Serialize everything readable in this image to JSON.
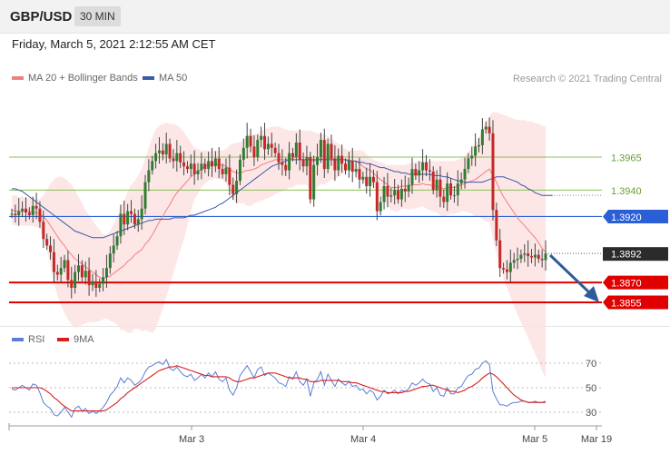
{
  "header": {
    "symbol": "GBP/USD",
    "timeframe": "30 MIN",
    "datetime": "Friday, March 5, 2021 2:12:55 AM CET"
  },
  "legend_main": {
    "ma20_bb": "MA 20 + Bollinger Bands",
    "ma50": "MA 50"
  },
  "legend_rsi": {
    "rsi": "RSI",
    "ma9": "9MA"
  },
  "copyright": "Research © 2021 Trading Central",
  "colors": {
    "up_candle": "#2e7d32",
    "down_candle": "#c62828",
    "bollinger_fill": "#fde2e2",
    "ma20": "#f08080",
    "ma50": "#3b5aa6",
    "rsi": "#5b7fd6",
    "rsi_ma": "#d91e1e",
    "support": "#e00000",
    "pivot": "#2a5fd6",
    "resistance": "#8cbf5a",
    "arrow": "#2f5b9a"
  },
  "chart_data": [
    {
      "type": "candlestick",
      "title": "",
      "x_ticks": [
        "Mar 3",
        "Mar 4",
        "Mar 5",
        "Mar 19"
      ],
      "ylim": [
        1.3845,
        1.3995
      ],
      "levels": [
        {
          "value": 1.3965,
          "label": "1.3965",
          "kind": "resistance"
        },
        {
          "value": 1.394,
          "label": "1.3940",
          "kind": "resistance"
        },
        {
          "value": 1.392,
          "label": "1.3920",
          "kind": "pivot"
        },
        {
          "value": 1.3892,
          "label": "1.3892",
          "kind": "last"
        },
        {
          "value": 1.387,
          "label": "1.3870",
          "kind": "support"
        },
        {
          "value": 1.3855,
          "label": "1.3855",
          "kind": "support"
        }
      ],
      "close": [
        1.3922,
        1.3921,
        1.3924,
        1.3926,
        1.3923,
        1.3921,
        1.3928,
        1.3926,
        1.3916,
        1.3903,
        1.3898,
        1.3893,
        1.3878,
        1.3876,
        1.3881,
        1.3887,
        1.3872,
        1.3866,
        1.3878,
        1.3883,
        1.3874,
        1.3879,
        1.3868,
        1.3871,
        1.3866,
        1.3869,
        1.3874,
        1.3881,
        1.3892,
        1.3898,
        1.3905,
        1.3922,
        1.3914,
        1.3924,
        1.3922,
        1.3914,
        1.3918,
        1.3926,
        1.3946,
        1.3955,
        1.3962,
        1.3968,
        1.397,
        1.3967,
        1.3975,
        1.3964,
        1.3962,
        1.3968,
        1.3961,
        1.3958,
        1.3956,
        1.396,
        1.3952,
        1.3955,
        1.396,
        1.3956,
        1.3962,
        1.3958,
        1.3964,
        1.3956,
        1.3952,
        1.3957,
        1.3944,
        1.3937,
        1.3947,
        1.3963,
        1.3972,
        1.3981,
        1.3973,
        1.3965,
        1.3978,
        1.3981,
        1.3971,
        1.3975,
        1.3972,
        1.3968,
        1.3961,
        1.3959,
        1.3955,
        1.3968,
        1.3965,
        1.3976,
        1.3963,
        1.3958,
        1.3965,
        1.3933,
        1.3959,
        1.3965,
        1.3978,
        1.3956,
        1.3975,
        1.3964,
        1.3955,
        1.3966,
        1.396,
        1.3955,
        1.3962,
        1.3954,
        1.3956,
        1.3948,
        1.395,
        1.3943,
        1.395,
        1.3946,
        1.3924,
        1.3931,
        1.3943,
        1.3935,
        1.3936,
        1.394,
        1.3933,
        1.3941,
        1.3939,
        1.3944,
        1.3956,
        1.3951,
        1.3955,
        1.3961,
        1.3955,
        1.3954,
        1.394,
        1.3948,
        1.3935,
        1.3931,
        1.3945,
        1.3936,
        1.3936,
        1.3945,
        1.3948,
        1.3956,
        1.3964,
        1.3966,
        1.3973,
        1.3974,
        1.3986,
        1.3988,
        1.3983,
        1.3925,
        1.3902,
        1.3881,
        1.388,
        1.3878,
        1.3885,
        1.3887,
        1.3888,
        1.3891,
        1.3892,
        1.389,
        1.3889,
        1.3891,
        1.3888,
        1.3887,
        1.3892
      ],
      "ma20": [
        1.3925,
        1.3924,
        1.3924,
        1.3924,
        1.3924,
        1.3924,
        1.3923,
        1.3923,
        1.3922,
        1.392,
        1.3917,
        1.3913,
        1.3909,
        1.3905,
        1.3901,
        1.3898,
        1.3894,
        1.3891,
        1.3888,
        1.3886,
        1.3884,
        1.3882,
        1.388,
        1.3878,
        1.3876,
        1.3874,
        1.3873,
        1.3874,
        1.3875,
        1.3877,
        1.3879,
        1.3881,
        1.3883,
        1.3886,
        1.3888,
        1.3891,
        1.3893,
        1.3895,
        1.3899,
        1.3902,
        1.3906,
        1.3911,
        1.3916,
        1.392,
        1.3925,
        1.3929,
        1.3934,
        1.3938,
        1.3941,
        1.3944,
        1.3947,
        1.395,
        1.3952,
        1.3954,
        1.3956,
        1.3958,
        1.3959,
        1.3959,
        1.396,
        1.3959,
        1.3959,
        1.3958,
        1.3956,
        1.3954,
        1.3953,
        1.3953,
        1.3954,
        1.3955,
        1.3955,
        1.3956,
        1.3957,
        1.3959,
        1.396,
        1.3961,
        1.3962,
        1.3963,
        1.3963,
        1.3963,
        1.3963,
        1.3964,
        1.3964,
        1.3965,
        1.3965,
        1.3965,
        1.3965,
        1.3962,
        1.3962,
        1.3963,
        1.3964,
        1.3963,
        1.3964,
        1.3964,
        1.3963,
        1.3963,
        1.3963,
        1.3963,
        1.3963,
        1.3962,
        1.3962,
        1.396,
        1.3958,
        1.3956,
        1.3955,
        1.3953,
        1.395,
        1.3948,
        1.3946,
        1.3944,
        1.3942,
        1.3942,
        1.3942,
        1.3943,
        1.3943,
        1.3943,
        1.3944,
        1.3944,
        1.3944,
        1.3945,
        1.3944,
        1.3944,
        1.3943,
        1.3943,
        1.3942,
        1.3941,
        1.3942,
        1.3942,
        1.3942,
        1.3943,
        1.3944,
        1.3945,
        1.3946,
        1.3947,
        1.3948,
        1.395,
        1.3952,
        1.3954,
        1.3956,
        1.3951,
        1.3946,
        1.394,
        1.3935,
        1.3931,
        1.3927,
        1.3923,
        1.3919,
        1.3916,
        1.3913,
        1.391,
        1.3907,
        1.3904,
        1.39,
        1.3896,
        1.3893
      ],
      "bb_upper": [
        1.3936,
        1.3936,
        1.3935,
        1.3935,
        1.3934,
        1.3934,
        1.3934,
        1.3933,
        1.3933,
        1.3936,
        1.394,
        1.3945,
        1.3948,
        1.395,
        1.395,
        1.3949,
        1.3947,
        1.3944,
        1.394,
        1.3935,
        1.393,
        1.3925,
        1.3921,
        1.3917,
        1.3913,
        1.391,
        1.3906,
        1.3906,
        1.3909,
        1.3914,
        1.392,
        1.3928,
        1.3932,
        1.3939,
        1.3944,
        1.3947,
        1.3951,
        1.3956,
        1.3964,
        1.3972,
        1.398,
        1.3986,
        1.3989,
        1.399,
        1.3991,
        1.399,
        1.399,
        1.3989,
        1.3987,
        1.3984,
        1.398,
        1.3976,
        1.3972,
        1.3971,
        1.397,
        1.397,
        1.397,
        1.397,
        1.397,
        1.397,
        1.397,
        1.3971,
        1.3974,
        1.3975,
        1.3976,
        1.3976,
        1.3978,
        1.3982,
        1.3982,
        1.3982,
        1.3983,
        1.3985,
        1.3986,
        1.3987,
        1.3988,
        1.3988,
        1.3988,
        1.3987,
        1.3986,
        1.3985,
        1.3985,
        1.3985,
        1.3985,
        1.3985,
        1.3985,
        1.3985,
        1.3984,
        1.3983,
        1.3982,
        1.3982,
        1.3981,
        1.3979,
        1.3977,
        1.3975,
        1.3973,
        1.3971,
        1.397,
        1.397,
        1.397,
        1.397,
        1.397,
        1.3967,
        1.3965,
        1.3963,
        1.3962,
        1.3961,
        1.396,
        1.3959,
        1.3959,
        1.3959,
        1.3959,
        1.3959,
        1.3959,
        1.396,
        1.3961,
        1.3961,
        1.3962,
        1.3962,
        1.3962,
        1.3962,
        1.3962,
        1.3962,
        1.3962,
        1.3962,
        1.3962,
        1.3962,
        1.3962,
        1.3963,
        1.3964,
        1.3966,
        1.3969,
        1.3972,
        1.3976,
        1.398,
        1.3986,
        1.3991,
        1.3996,
        1.3999,
        1.3999,
        1.3998,
        1.3997,
        1.3996,
        1.3995,
        1.3994,
        1.3993,
        1.3993,
        1.3993,
        1.3992,
        1.3992,
        1.3991,
        1.399,
        1.3989,
        1.3988
      ],
      "bb_lower": [
        1.3914,
        1.3913,
        1.3913,
        1.3913,
        1.3913,
        1.3913,
        1.3913,
        1.3912,
        1.3911,
        1.3904,
        1.3895,
        1.3882,
        1.387,
        1.386,
        1.3853,
        1.3847,
        1.3842,
        1.3838,
        1.3836,
        1.3836,
        1.3838,
        1.3839,
        1.384,
        1.384,
        1.384,
        1.3841,
        1.3842,
        1.3843,
        1.3841,
        1.384,
        1.3838,
        1.3834,
        1.3834,
        1.3832,
        1.3832,
        1.3835,
        1.3835,
        1.3833,
        1.3834,
        1.3833,
        1.3832,
        1.3835,
        1.3843,
        1.385,
        1.3859,
        1.3868,
        1.3877,
        1.3886,
        1.3895,
        1.3903,
        1.3913,
        1.3924,
        1.3933,
        1.3937,
        1.3942,
        1.3945,
        1.3947,
        1.3948,
        1.3949,
        1.3948,
        1.3948,
        1.3945,
        1.3938,
        1.3933,
        1.393,
        1.393,
        1.393,
        1.3928,
        1.3928,
        1.393,
        1.3931,
        1.3932,
        1.3933,
        1.3934,
        1.3935,
        1.3937,
        1.3938,
        1.3939,
        1.394,
        1.3942,
        1.3942,
        1.3944,
        1.3944,
        1.3944,
        1.3944,
        1.3939,
        1.394,
        1.3942,
        1.3945,
        1.3944,
        1.3946,
        1.3948,
        1.3948,
        1.395,
        1.3952,
        1.3954,
        1.3955,
        1.3954,
        1.3953,
        1.395,
        1.3946,
        1.3945,
        1.3944,
        1.3943,
        1.3937,
        1.3934,
        1.3932,
        1.3928,
        1.3925,
        1.3924,
        1.3924,
        1.3926,
        1.3926,
        1.3925,
        1.3926,
        1.3926,
        1.3927,
        1.3928,
        1.3926,
        1.3925,
        1.3924,
        1.3923,
        1.3921,
        1.392,
        1.3921,
        1.3922,
        1.3922,
        1.3923,
        1.3924,
        1.3924,
        1.3923,
        1.3922,
        1.392,
        1.392,
        1.3918,
        1.3916,
        1.3916,
        1.3903,
        1.3892,
        1.3882,
        1.3873,
        1.3866,
        1.3859,
        1.3852,
        1.3846,
        1.384,
        1.3834,
        1.3828,
        1.3822,
        1.3816,
        1.381,
        1.3803,
        1.3798
      ],
      "ma50": [
        1.3941,
        1.3941,
        1.394,
        1.3939,
        1.3937,
        1.3935,
        1.3933,
        1.3931,
        1.3929,
        1.3927,
        1.3925,
        1.3923,
        1.3921,
        1.3919,
        1.3917,
        1.3915,
        1.3913,
        1.3911,
        1.3909,
        1.3908,
        1.3907,
        1.3906,
        1.3905,
        1.3904,
        1.3904,
        1.3904,
        1.3904,
        1.3905,
        1.3906,
        1.3907,
        1.3908,
        1.3909,
        1.391,
        1.3911,
        1.3912,
        1.3913,
        1.3914,
        1.3915,
        1.3916,
        1.3917,
        1.3917,
        1.3918,
        1.3918,
        1.3918,
        1.3918,
        1.3918,
        1.3919,
        1.3919,
        1.3919,
        1.3919,
        1.392,
        1.3921,
        1.3921,
        1.3922,
        1.3923,
        1.3924,
        1.3925,
        1.3926,
        1.3927,
        1.3929,
        1.393,
        1.3932,
        1.3934,
        1.3936,
        1.3938,
        1.394,
        1.3942,
        1.3944,
        1.3946,
        1.3948,
        1.395,
        1.3952,
        1.3954,
        1.3956,
        1.3958,
        1.3959,
        1.396,
        1.3961,
        1.3962,
        1.3963,
        1.3963,
        1.3963,
        1.3963,
        1.3963,
        1.3963,
        1.3963,
        1.3963,
        1.3963,
        1.3963,
        1.3963,
        1.3963,
        1.3963,
        1.3963,
        1.3963,
        1.3963,
        1.3963,
        1.3962,
        1.3962,
        1.3962,
        1.3961,
        1.3961,
        1.396,
        1.396,
        1.3959,
        1.3958,
        1.3957,
        1.3957,
        1.3956,
        1.3955,
        1.3954,
        1.3954,
        1.3953,
        1.3953,
        1.3952,
        1.3952,
        1.3952,
        1.3952,
        1.3952,
        1.3952,
        1.3952,
        1.3951,
        1.3951,
        1.3951,
        1.395,
        1.395,
        1.3949,
        1.3948,
        1.3947,
        1.3947,
        1.3946,
        1.3946,
        1.3946,
        1.3946,
        1.3946,
        1.3946,
        1.3947,
        1.3948,
        1.3949,
        1.395,
        1.395,
        1.395,
        1.3949,
        1.3948,
        1.3947,
        1.3946,
        1.3944,
        1.3943,
        1.3941,
        1.394,
        1.3938,
        1.3937,
        1.3936,
        1.3936,
        1.3936,
        1.3936
      ]
    },
    {
      "type": "line",
      "title": "",
      "y_ticks": [
        "30",
        "50",
        "70"
      ],
      "ylim": [
        20,
        80
      ],
      "series": [
        {
          "name": "RSI",
          "values": [
            49,
            48,
            50,
            52,
            50,
            48,
            53,
            52,
            46,
            38,
            35,
            33,
            28,
            27,
            30,
            34,
            30,
            26,
            33,
            35,
            31,
            33,
            29,
            31,
            29,
            31,
            34,
            38,
            44,
            47,
            51,
            58,
            54,
            58,
            56,
            52,
            54,
            57,
            63,
            67,
            68,
            70,
            71,
            69,
            73,
            66,
            64,
            67,
            63,
            60,
            59,
            61,
            56,
            58,
            61,
            58,
            62,
            59,
            63,
            57,
            55,
            58,
            48,
            44,
            50,
            60,
            64,
            68,
            63,
            58,
            65,
            67,
            60,
            62,
            60,
            58,
            54,
            53,
            51,
            59,
            57,
            63,
            55,
            52,
            57,
            43,
            54,
            57,
            63,
            52,
            61,
            56,
            51,
            57,
            54,
            52,
            55,
            51,
            52,
            48,
            49,
            45,
            48,
            46,
            40,
            43,
            48,
            45,
            46,
            48,
            45,
            48,
            47,
            49,
            54,
            52,
            54,
            57,
            54,
            53,
            47,
            50,
            44,
            43,
            50,
            45,
            45,
            50,
            51,
            56,
            60,
            61,
            65,
            66,
            70,
            72,
            69,
            47,
            41,
            36,
            36,
            35,
            37,
            38,
            38,
            39,
            39,
            38,
            38,
            39,
            38,
            38,
            39
          ]
        },
        {
          "name": "9MA",
          "values": [
            50,
            50,
            50,
            50,
            50,
            50,
            50,
            50,
            50,
            49,
            47,
            45,
            42,
            40,
            37,
            35,
            33,
            31,
            31,
            31,
            31,
            31,
            31,
            31,
            31,
            31,
            31,
            32,
            34,
            36,
            38,
            41,
            43,
            46,
            48,
            50,
            52,
            54,
            56,
            58,
            60,
            62,
            64,
            65,
            66,
            67,
            67,
            68,
            67,
            66,
            65,
            64,
            63,
            62,
            61,
            60,
            60,
            59,
            59,
            59,
            59,
            59,
            58,
            56,
            55,
            55,
            56,
            57,
            58,
            58,
            59,
            60,
            61,
            62,
            62,
            62,
            61,
            60,
            59,
            58,
            58,
            58,
            58,
            57,
            57,
            55,
            55,
            55,
            56,
            56,
            56,
            56,
            56,
            56,
            55,
            55,
            55,
            54,
            54,
            53,
            52,
            51,
            50,
            49,
            48,
            47,
            47,
            46,
            46,
            46,
            46,
            46,
            47,
            47,
            48,
            49,
            50,
            51,
            51,
            52,
            52,
            51,
            50,
            49,
            48,
            47,
            47,
            46,
            47,
            48,
            50,
            51,
            53,
            55,
            58,
            60,
            62,
            61,
            59,
            56,
            53,
            50,
            47,
            44,
            42,
            40,
            39,
            38,
            38,
            38,
            38,
            38,
            38
          ]
        }
      ]
    }
  ]
}
